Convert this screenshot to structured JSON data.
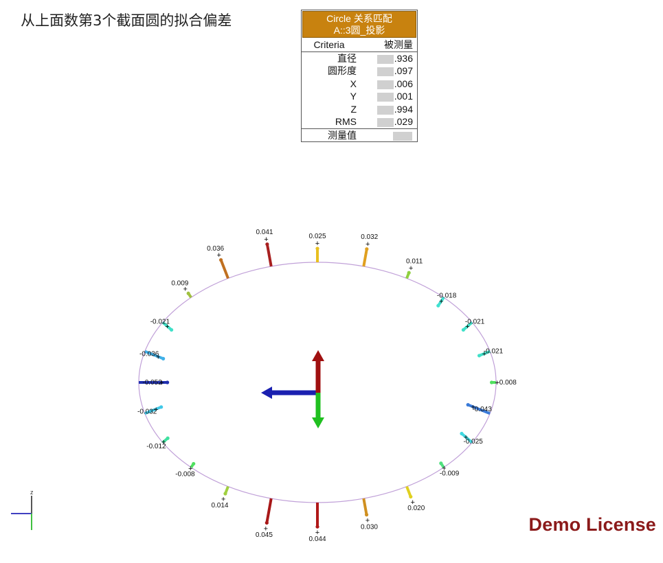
{
  "page": {
    "title": "从上面数第3个截面圆的拟合偏差"
  },
  "table": {
    "header_line1": "Circle 关系匹配",
    "header_line2": "A::3圆_投影",
    "col_criteria": "Criteria",
    "col_measured": "被测量",
    "rows": [
      {
        "label": "直径",
        "value": ".936"
      },
      {
        "label": "圆形度",
        "value": ".097"
      },
      {
        "label": "X",
        "value": ".006"
      },
      {
        "label": "Y",
        "value": ".001"
      },
      {
        "label": "Z",
        "value": ".994"
      },
      {
        "label": "RMS",
        "value": ".029"
      }
    ],
    "measure_label": "测量值",
    "measure_value": ""
  },
  "deviations": [
    {
      "value": "0.025",
      "deviation": 0.025,
      "color": "#e8c020"
    },
    {
      "value": "0.032",
      "deviation": 0.032,
      "color": "#e0a020"
    },
    {
      "value": "0.011",
      "deviation": 0.011,
      "color": "#90d040"
    },
    {
      "value": "-0.018",
      "deviation": -0.018,
      "color": "#40e0d0"
    },
    {
      "value": "-0.021",
      "deviation": -0.021,
      "color": "#40e0c8"
    },
    {
      "value": "-0.021",
      "deviation": -0.021,
      "color": "#40e0c8"
    },
    {
      "value": "-0.008",
      "deviation": -0.008,
      "color": "#50e060"
    },
    {
      "value": "-0.043",
      "deviation": -0.043,
      "color": "#3a7ad8"
    },
    {
      "value": "-0.025",
      "deviation": -0.025,
      "color": "#40d8e0"
    },
    {
      "value": "-0.009",
      "deviation": -0.009,
      "color": "#50e080"
    },
    {
      "value": "0.020",
      "deviation": 0.02,
      "color": "#e0d020"
    },
    {
      "value": "0.030",
      "deviation": 0.03,
      "color": "#d09020"
    },
    {
      "value": "0.044",
      "deviation": 0.044,
      "color": "#b01818"
    },
    {
      "value": "0.045",
      "deviation": 0.045,
      "color": "#a81818"
    },
    {
      "value": "0.014",
      "deviation": 0.014,
      "color": "#a0d040"
    },
    {
      "value": "-0.008",
      "deviation": -0.008,
      "color": "#50e060"
    },
    {
      "value": "-0.012",
      "deviation": -0.012,
      "color": "#40e0a0"
    },
    {
      "value": "-0.032",
      "deviation": -0.032,
      "color": "#40c8e8"
    },
    {
      "value": "-0.052",
      "deviation": -0.052,
      "color": "#2030b0"
    },
    {
      "value": "-0.036",
      "deviation": -0.036,
      "color": "#40b0e8"
    },
    {
      "value": "-0.021",
      "deviation": -0.021,
      "color": "#40e0c8"
    },
    {
      "value": "0.009",
      "deviation": 0.009,
      "color": "#a0c040"
    },
    {
      "value": "0.036",
      "deviation": 0.036,
      "color": "#c07020"
    },
    {
      "value": "0.041",
      "deviation": 0.041,
      "color": "#a82020"
    }
  ],
  "axes": {
    "x_color": "#1a20b0",
    "y_color": "#a01010",
    "z_color": "#20c020"
  },
  "triad": {
    "z_label": "z"
  },
  "watermark": "Demo License"
}
